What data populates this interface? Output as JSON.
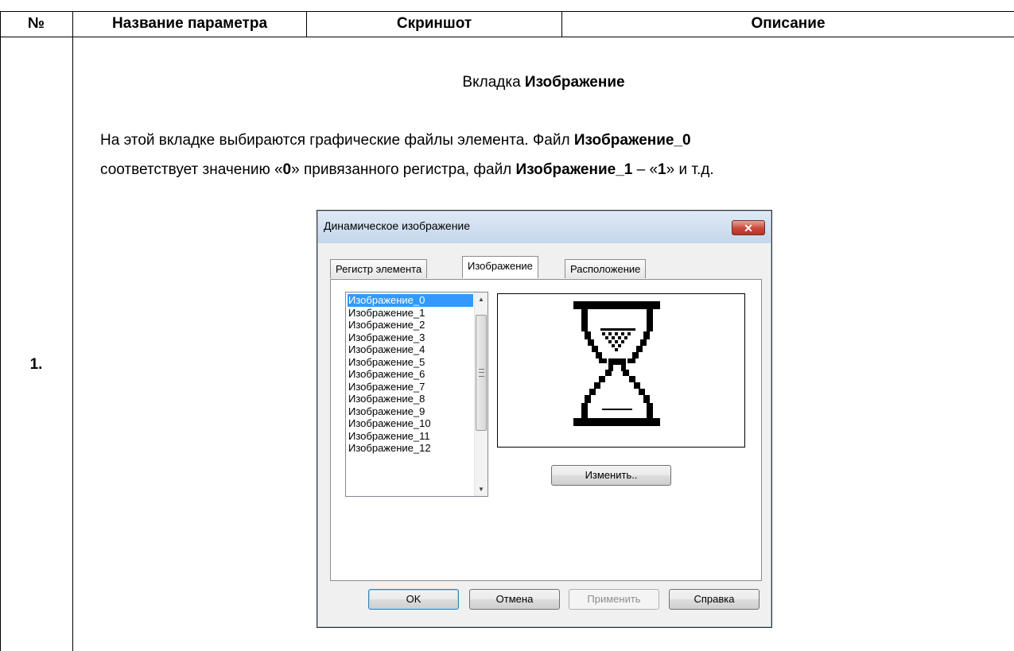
{
  "table": {
    "headers": {
      "num": "№",
      "param_name": "Название параметра",
      "screenshot": "Скриншот",
      "description": "Описание"
    },
    "row_number": "1.",
    "tab_title_prefix": "Вкладка ",
    "tab_title_bold": "Изображение",
    "para": {
      "l1_text": "На этой вкладке выбираются графические файлы элемента. Файл ",
      "l1_bold": "Изображение_0",
      "l2_t1": "соответствует значению «",
      "l2_b1": "0",
      "l2_t2": "» привязанного регистра, файл ",
      "l2_b2": "Изображение_1",
      "l2_t3": " – «",
      "l2_b3": "1",
      "l2_t4": "» и т.д."
    }
  },
  "dialog": {
    "title": "Динамическое изображение",
    "close_glyph": "✕",
    "tabs": [
      "Регистр элемента",
      "Изображение",
      "Расположение"
    ],
    "active_tab": "Изображение",
    "list_items": [
      "Изображение_0",
      "Изображение_1",
      "Изображение_2",
      "Изображение_3",
      "Изображение_4",
      "Изображение_5",
      "Изображение_6",
      "Изображение_7",
      "Изображение_8",
      "Изображение_9",
      "Изображение_10",
      "Изображение_11",
      "Изображение_12"
    ],
    "selected_item": "Изображение_0",
    "preview_icon": "hourglass-icon",
    "change_button": "Изменить..",
    "buttons": {
      "ok": "OK",
      "cancel": "Отмена",
      "apply": "Применить",
      "help": "Справка"
    },
    "colors": {
      "selection": "#3399ff",
      "close_button": "#c9473b",
      "title_bar": "#c4d6ec"
    }
  }
}
